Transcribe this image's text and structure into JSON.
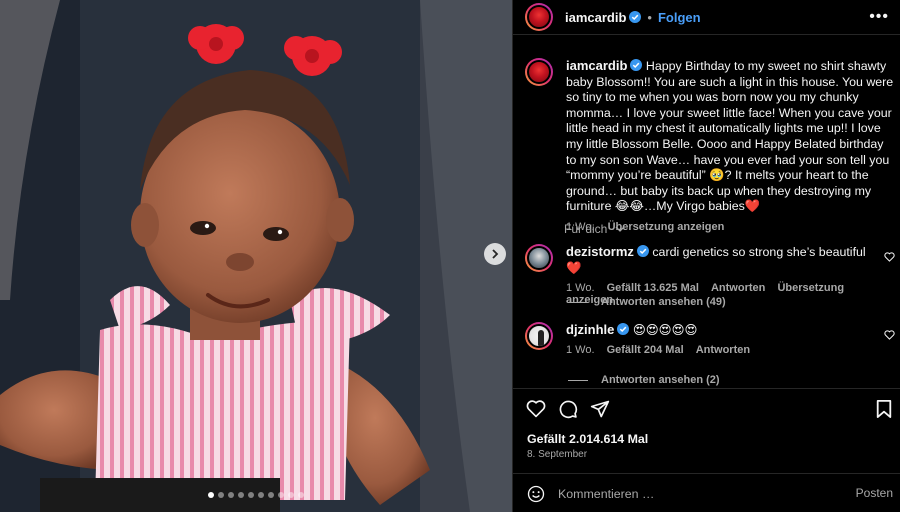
{
  "photo": {
    "alt": "baby in pink striped top with red flower hair clips",
    "colors": {
      "background": "#2b3340",
      "top": "#f3c6d5",
      "skin": "#a8664a",
      "clip": "#e8232f"
    },
    "carousel": {
      "slides": 10,
      "active_index": 0
    }
  },
  "header": {
    "username": "iamcardib",
    "separator": "•",
    "follow_label": "Folgen",
    "more_icon": "more-horizontal-icon"
  },
  "caption": {
    "username": "iamcardib",
    "text": "Happy Birthday to my sweet no shirt shawty baby Blossom!! You are such a light in this house. You were so tiny to me when you was born now you my chunky momma… I love your sweet little face! When you cave your little head in my chest it automatically lights me up!! I love my little Blossom Belle. Oooo and Happy Belated birthday to my son son Wave… have you ever had your son tell you “mommy you’re beautiful” 🥹? It melts your heart to the ground… but baby its back up when they destroying my furniture 😂😂…My Virgo babies❤️",
    "time": "1 Wo.",
    "translate_label": "Übersetzung anzeigen"
  },
  "for_you_label": "Für dich",
  "comments": [
    {
      "username": "dezistormz",
      "verified": true,
      "text": "cardi genetics so strong she’s beautiful ❤️",
      "time": "1 Wo.",
      "likes_label": "Gefällt 13.625 Mal",
      "reply_label": "Antworten",
      "translate_label": "Übersetzung anzeigen",
      "view_replies": "Antworten ansehen (49)"
    },
    {
      "username": "djzinhle",
      "verified": true,
      "text": "😍😍😍😍😍",
      "time": "1 Wo.",
      "likes_label": "Gefällt 204 Mal",
      "reply_label": "Antworten",
      "view_replies": "Antworten ansehen (2)"
    }
  ],
  "actions": {
    "icons": [
      "heart-icon",
      "comment-icon",
      "share-icon",
      "bookmark-icon"
    ],
    "likes_label": "Gefällt 2.014.614 Mal",
    "date": "8. September"
  },
  "comment_box": {
    "placeholder": "Kommentieren …",
    "post_label": "Posten"
  },
  "theme": {
    "background": "#000000",
    "text": "#f5f5f5",
    "secondary_text": "#a8a8a8",
    "link_blue": "#4a9ef8",
    "verified_blue": "#3897f0",
    "heart_red": "#ed4956"
  }
}
